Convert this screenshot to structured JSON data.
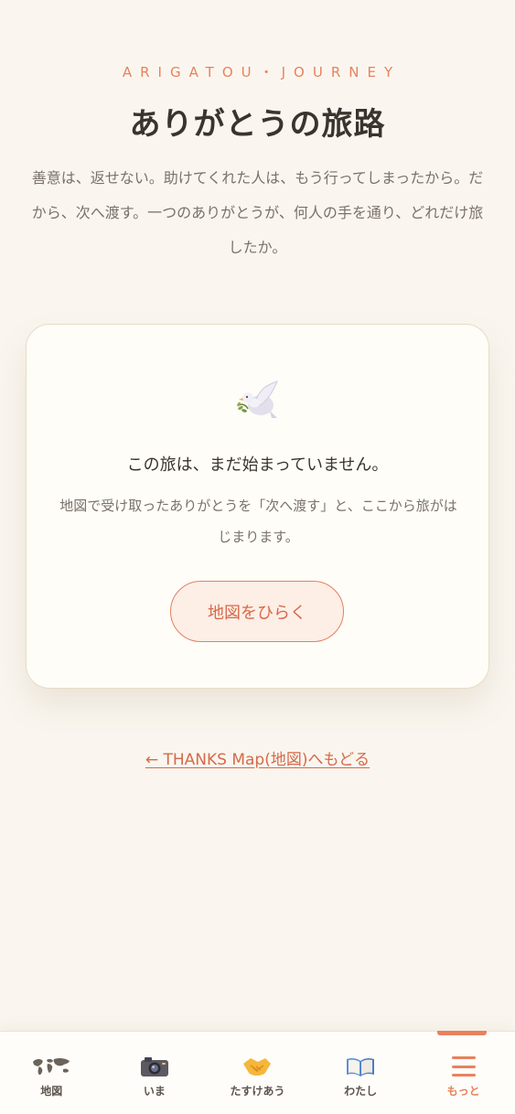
{
  "header": {
    "eyebrow": "ARIGATOU・JOURNEY",
    "title": "ありがとうの旅路",
    "lead": "善意は、返せない。助けてくれた人は、もう行ってしまったから。だから、次へ渡す。一つのありがとうが、何人の手を通り、どれだけ旅したか。"
  },
  "empty_state": {
    "icon": "dove-icon",
    "heading": "この旅は、まだ始まっていません。",
    "body": "地図で受け取ったありがとうを「次へ渡す」と、ここから旅がはじまります。",
    "button_label": "地図をひらく"
  },
  "back_link": {
    "label": "← THANKS Map(地図)へもどる"
  },
  "tabbar": {
    "active": "more",
    "items": [
      {
        "id": "map",
        "label": "地図",
        "icon": "world-map-icon"
      },
      {
        "id": "now",
        "label": "いま",
        "icon": "camera-icon"
      },
      {
        "id": "help",
        "label": "たすけあう",
        "icon": "handshake-icon"
      },
      {
        "id": "me",
        "label": "わたし",
        "icon": "open-book-icon"
      },
      {
        "id": "more",
        "label": "もっと",
        "icon": "menu-icon"
      }
    ]
  },
  "colors": {
    "accent": "#e8825d",
    "background": "#faf6ef",
    "card": "#fefdf8"
  }
}
